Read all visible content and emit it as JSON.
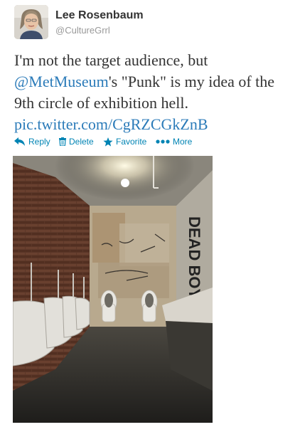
{
  "user": {
    "name": "Lee Rosenbaum",
    "handle": "@CultureGrrl"
  },
  "tweet": {
    "text_line1": "I'm not the target audience, but",
    "mention": "@MetMuseum",
    "text_line2_rest": "'s \"Punk\" is my idea of the",
    "text_line3": "9th circle of exhibition hell.",
    "pic_link": "pic.twitter.com/CgRZCGkZnB"
  },
  "actions": [
    {
      "label": "Reply",
      "icon": "reply-icon"
    },
    {
      "label": "Delete",
      "icon": "trash-icon"
    },
    {
      "label": "Favorite",
      "icon": "star-icon"
    },
    {
      "label": "More",
      "icon": "more-dots-icon"
    }
  ],
  "colors": {
    "link": "#2b7bb9",
    "action": "#0084b4",
    "handle": "#999999",
    "text": "#333333"
  },
  "photo": {
    "graffiti_text": "DEAD BOYS"
  }
}
